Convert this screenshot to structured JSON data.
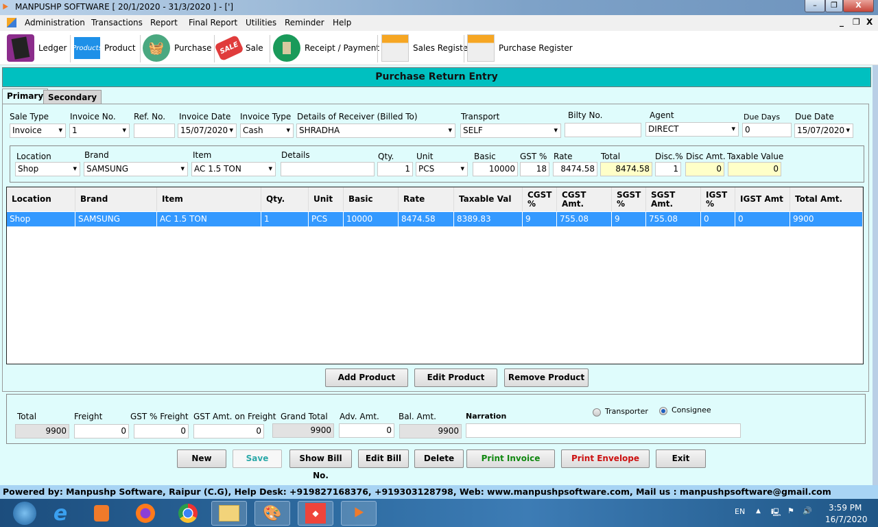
{
  "window": {
    "title": "MANPUSHP SOFTWARE [ 20/1/2020 - 31/3/2020 ]   - [']",
    "minimize": "–",
    "restore": "❐",
    "close": "X"
  },
  "menu": {
    "items": [
      "Administration",
      "Transactions",
      "Report",
      "Final Report",
      "Utilities",
      "Reminder",
      "Help"
    ],
    "mdi_minimize": "_",
    "mdi_restore": "❐",
    "mdi_close": "X"
  },
  "toolbar": {
    "items": [
      {
        "label": "Ledger",
        "icon": "ledger-book-icon"
      },
      {
        "label": "Product",
        "icon": "products-icon",
        "icon_text": "Products"
      },
      {
        "label": "Purchase",
        "icon": "basket-icon"
      },
      {
        "label": "Sale",
        "icon": "sale-tag-icon",
        "icon_text": "SALE"
      },
      {
        "label": "Receipt / Payment",
        "icon": "receipt-icon"
      },
      {
        "label": "Sales Register",
        "icon": "register-icon"
      },
      {
        "label": "Purchase Register",
        "icon": "register-icon"
      }
    ]
  },
  "form": {
    "title": "Purchase Return Entry",
    "tabs": [
      {
        "label": "Primary",
        "active": true
      },
      {
        "label": "Secondary",
        "active": false
      }
    ],
    "header": {
      "sale_type": {
        "label": "Sale Type",
        "value": "Invoice"
      },
      "invoice_no": {
        "label": "Invoice No.",
        "value": "1"
      },
      "ref_no": {
        "label": "Ref. No.",
        "value": ""
      },
      "invoice_date": {
        "label": "Invoice Date",
        "value": "15/07/2020"
      },
      "invoice_type": {
        "label": "Invoice Type",
        "value": "Cash"
      },
      "receiver": {
        "label": "Details of Receiver (Billed To)",
        "value": "SHRADHA"
      },
      "transport": {
        "label": "Transport",
        "value": "SELF"
      },
      "bilty_no": {
        "label": "Bilty No.",
        "value": ""
      },
      "agent": {
        "label": "Agent",
        "value": "DIRECT"
      },
      "due_days": {
        "label": "Due Days",
        "value": "0"
      },
      "due_date": {
        "label": "Due Date",
        "value": "15/07/2020"
      }
    },
    "item_entry": {
      "location": {
        "label": "Location",
        "value": "Shop"
      },
      "brand": {
        "label": "Brand",
        "value": "SAMSUNG"
      },
      "item": {
        "label": "Item",
        "value": "AC 1.5 TON"
      },
      "details": {
        "label": "Details",
        "value": ""
      },
      "qty": {
        "label": "Qty.",
        "value": "1"
      },
      "unit": {
        "label": "Unit",
        "value": "PCS"
      },
      "basic": {
        "label": "Basic",
        "value": "10000"
      },
      "gst_pct": {
        "label": "GST %",
        "value": "18"
      },
      "rate": {
        "label": "Rate",
        "value": "8474.58"
      },
      "total": {
        "label": "Total",
        "value": "8474.58"
      },
      "disc_pct": {
        "label": "Disc.%",
        "value": "1"
      },
      "disc_amt": {
        "label": "Disc Amt.",
        "value": "0"
      },
      "taxable_value": {
        "label": "Taxable Value",
        "value": "0"
      }
    },
    "grid": {
      "columns": [
        "Location",
        "Brand",
        "Item",
        "Qty.",
        "Unit",
        "Basic",
        "Rate",
        "Taxable Val",
        "CGST %",
        "CGST Amt.",
        "SGST %",
        "SGST Amt.",
        "IGST %",
        "IGST Amt",
        "Total Amt."
      ],
      "rows": [
        [
          "Shop",
          "SAMSUNG",
          "AC 1.5 TON",
          "1",
          "PCS",
          "10000",
          "8474.58",
          "8389.83",
          "9",
          "755.08",
          "9",
          "755.08",
          "0",
          "0",
          "9900"
        ]
      ]
    },
    "grid_buttons": {
      "add": "Add Product",
      "edit": "Edit Product",
      "remove": "Remove Product"
    },
    "footer": {
      "total": {
        "label": "Total",
        "value": "9900"
      },
      "freight": {
        "label": "Freight",
        "value": "0"
      },
      "gst_pct_freight": {
        "label": "GST % Freight",
        "value": "0"
      },
      "gst_amt_freight": {
        "label": "GST Amt. on Freight",
        "value": "0"
      },
      "grand_total": {
        "label": "Grand Total",
        "value": "9900"
      },
      "adv_amt": {
        "label": "Adv. Amt.",
        "value": "0"
      },
      "bal_amt": {
        "label": "Bal. Amt.",
        "value": "9900"
      },
      "narration": {
        "label": "Narration",
        "value": ""
      },
      "radio": [
        {
          "label": "Transporter",
          "checked": false
        },
        {
          "label": "Consignee",
          "checked": true
        }
      ]
    },
    "actions": {
      "new": "New",
      "save": "Save",
      "show_bill": "Show Bill No.",
      "edit_bill": "Edit Bill",
      "delete": "Delete",
      "print_invoice": "Print Invoice",
      "print_envelope": "Print Envelope",
      "exit": "Exit"
    },
    "colors": {
      "header_bg": "#00c0c0",
      "form_bg": "#dffcfc",
      "selected_row": "#3399ff",
      "print_invoice": "#118811",
      "print_envelope": "#cc1111",
      "save": "#2aa8a8"
    }
  },
  "status_bar": "Powered by: Manpushp Software, Raipur (C.G), Help Desk: +919827168376, +919303128798, Web: www.manpushpsoftware.com,  Mail us :  manpushpsoftware@gmail.com",
  "taskbar": {
    "apps": [
      "start-orb",
      "internet-explorer",
      "media-player",
      "firefox",
      "chrome",
      "file-explorer",
      "paint",
      "anydesk",
      "manpushp"
    ],
    "lang": "EN",
    "time": "3:59 PM",
    "date": "16/7/2020"
  }
}
